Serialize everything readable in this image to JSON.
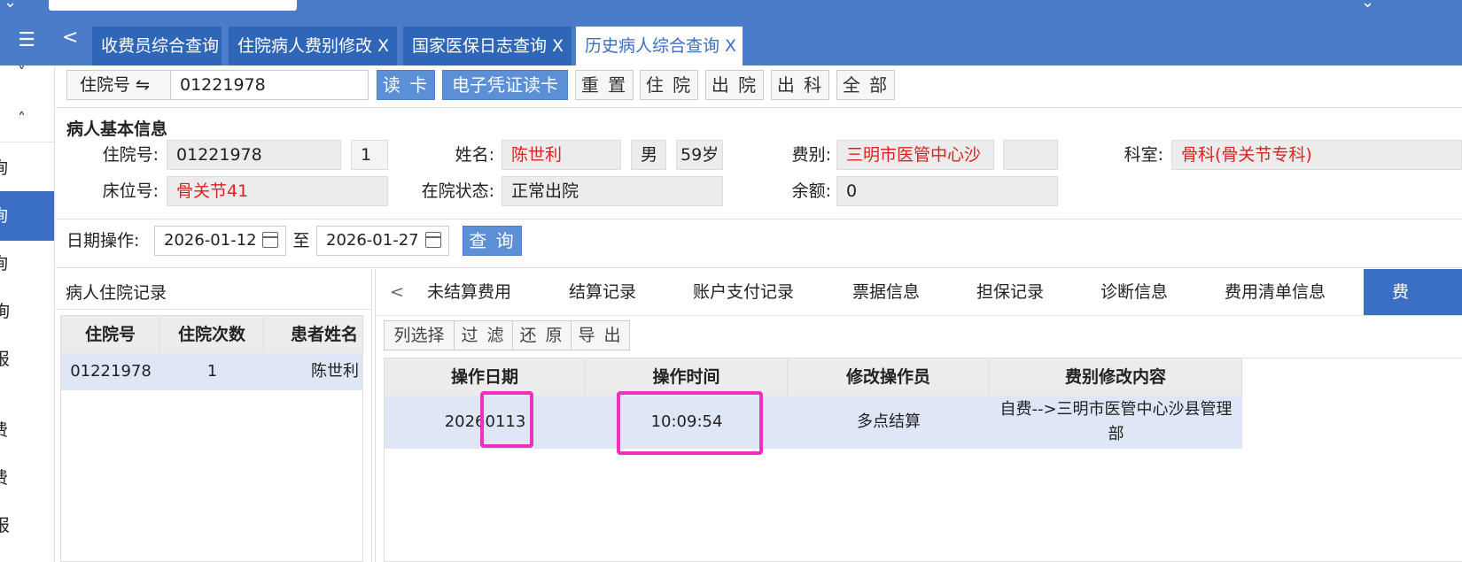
{
  "header": {
    "menu_icon": "menu-icon",
    "back_icon": "chevron-left-icon",
    "tabs": [
      {
        "label": "收费员综合查询",
        "closable": false,
        "active": false
      },
      {
        "label": "住院病人费别修改",
        "closable": true,
        "active": false
      },
      {
        "label": "国家医保日志查询",
        "closable": true,
        "active": false
      },
      {
        "label": "历史病人综合查询",
        "closable": true,
        "active": true
      }
    ],
    "close_glyph": "X"
  },
  "sidebar": {
    "caret_down": "˅",
    "caret_up": "˄",
    "items": [
      "询",
      "询",
      "询",
      "询",
      "报",
      "费",
      "费",
      "报"
    ]
  },
  "search_bar": {
    "field_label": "住院号 ⇋",
    "field_value": "01221978",
    "buttons": [
      "读 卡",
      "电子凭证读卡",
      "重 置",
      "住 院",
      "出 院",
      "出 科",
      "全 部"
    ]
  },
  "patient_info": {
    "title": "病人基本信息",
    "admission_no_label": "住院号:",
    "admission_no": "01221978",
    "admission_count": "1",
    "name_label": "姓名:",
    "name": "陈世利",
    "gender": "男",
    "age": "59岁",
    "fee_type_label": "费别:",
    "fee_type": "三明市医管中心沙",
    "department_label": "科室:",
    "department": "骨科(骨关节专科)",
    "bed_label": "床位号:",
    "bed": "骨关节41",
    "status_label": "在院状态:",
    "status": "正常出院",
    "balance_label": "余额:",
    "balance": "0"
  },
  "date_filter": {
    "label": "日期操作:",
    "start": "2026-01-12",
    "to_label": "至",
    "end": "2026-01-27",
    "query_button": "查 询"
  },
  "records": {
    "title": "病人住院记录",
    "columns": [
      "住院号",
      "住院次数",
      "患者姓名"
    ],
    "rows": [
      [
        "01221978",
        "1",
        "陈世利"
      ]
    ]
  },
  "detail_tabs": {
    "prev_icon": "chevron-left-icon",
    "tabs": [
      "未结算费用",
      "结算记录",
      "账户支付记录",
      "票据信息",
      "担保记录",
      "诊断信息",
      "费用清单信息",
      "费"
    ],
    "toolbar": [
      "列选择",
      "过 滤",
      "还 原",
      "导 出"
    ],
    "columns": [
      "操作日期",
      "操作时间",
      "修改操作员",
      "费别修改内容"
    ],
    "rows": [
      [
        "20260113",
        "10:09:54",
        "多点结算",
        "自费-->三明市医管中心沙县管理部"
      ]
    ]
  },
  "colors": {
    "brand_blue": "#4a7cc9",
    "tab_blue": "#2f66b8",
    "highlight": "#ee2fc0",
    "red_text": "#e02020"
  }
}
